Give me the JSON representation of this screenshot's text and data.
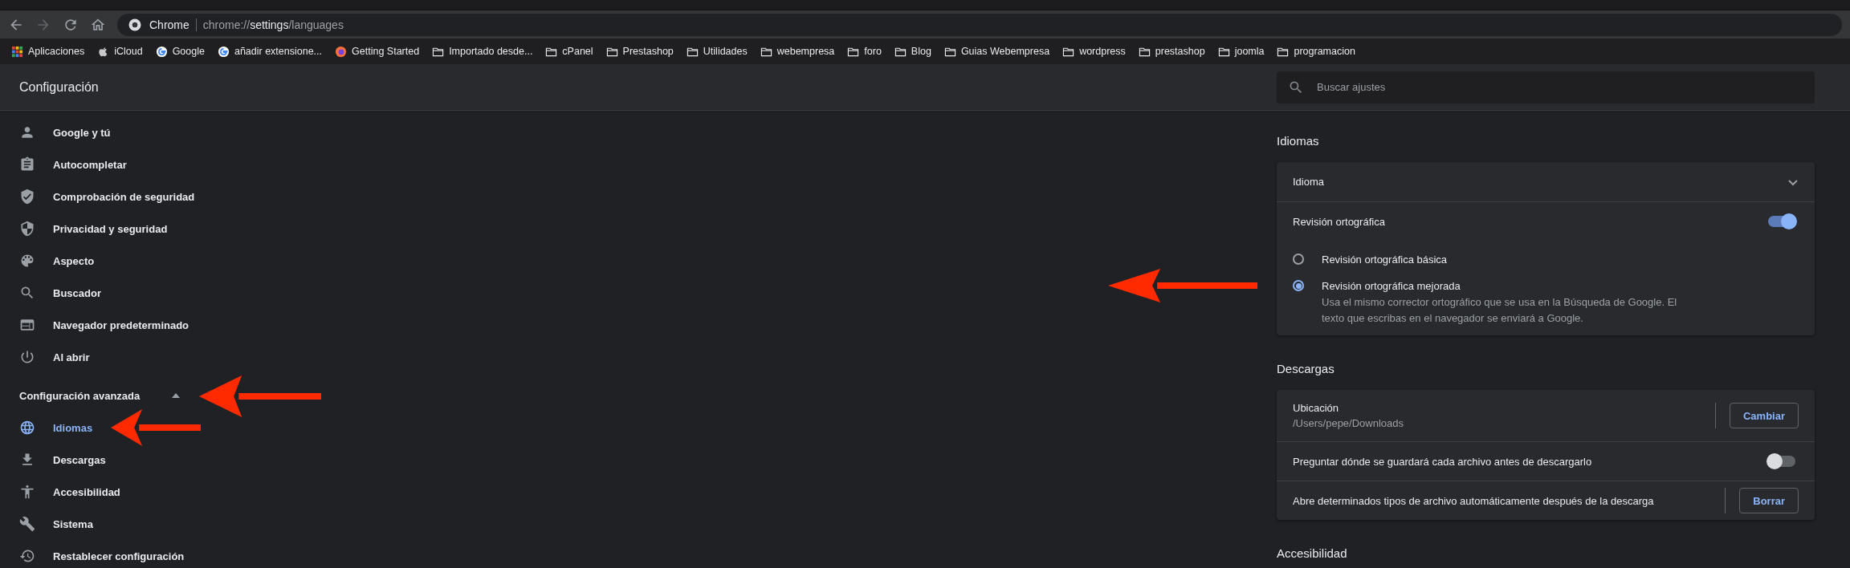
{
  "browser": {
    "address_bar": {
      "site_label": "Chrome",
      "url_scheme": "chrome://",
      "url_host": "settings",
      "url_path": "/languages"
    },
    "bookmarks": [
      {
        "label": "Aplicaciones",
        "kind": "apps"
      },
      {
        "label": "iCloud",
        "kind": "apple"
      },
      {
        "label": "Google",
        "kind": "google"
      },
      {
        "label": "añadir extensione...",
        "kind": "google"
      },
      {
        "label": "Getting Started",
        "kind": "firefox"
      },
      {
        "label": "Importado desde...",
        "kind": "folder"
      },
      {
        "label": "cPanel",
        "kind": "folder"
      },
      {
        "label": "Prestashop",
        "kind": "folder"
      },
      {
        "label": "Utilidades",
        "kind": "folder"
      },
      {
        "label": "webempresa",
        "kind": "folder"
      },
      {
        "label": "foro",
        "kind": "folder"
      },
      {
        "label": "Blog",
        "kind": "folder"
      },
      {
        "label": "Guias Webempresa",
        "kind": "folder"
      },
      {
        "label": "wordpress",
        "kind": "folder"
      },
      {
        "label": "prestashop",
        "kind": "folder"
      },
      {
        "label": "joomla",
        "kind": "folder"
      },
      {
        "label": "programacion",
        "kind": "folder"
      }
    ]
  },
  "settings": {
    "title": "Configuración",
    "search": {
      "placeholder": "Buscar ajustes"
    },
    "sidebar": {
      "items": [
        {
          "label": "Google y tú",
          "selected": false
        },
        {
          "label": "Autocompletar",
          "selected": false
        },
        {
          "label": "Comprobación de seguridad",
          "selected": false
        },
        {
          "label": "Privacidad y seguridad",
          "selected": false
        },
        {
          "label": "Aspecto",
          "selected": false
        },
        {
          "label": "Buscador",
          "selected": false
        },
        {
          "label": "Navegador predeterminado",
          "selected": false
        },
        {
          "label": "Al abrir",
          "selected": false
        }
      ],
      "advanced": {
        "label": "Configuración avanzada",
        "expanded": true
      },
      "advanced_items": [
        {
          "label": "Idiomas",
          "selected": true
        },
        {
          "label": "Descargas",
          "selected": false
        },
        {
          "label": "Accesibilidad",
          "selected": false
        },
        {
          "label": "Sistema",
          "selected": false
        },
        {
          "label": "Restablecer configuración",
          "selected": false
        }
      ]
    },
    "sections": [
      {
        "title": "Idiomas",
        "rows": [
          {
            "kind": "expander",
            "label": "Idioma",
            "expanded": false
          },
          {
            "kind": "toggle",
            "label": "Revisión ortográfica",
            "on": true
          },
          {
            "kind": "radio",
            "label": "Revisión ortográfica básica",
            "selected": false
          },
          {
            "kind": "radio",
            "label": "Revisión ortográfica mejorada",
            "selected": true,
            "description": "Usa el mismo corrector ortográfico que se usa en la Búsqueda de Google. El texto que escribas en el navegador se enviará a Google."
          }
        ]
      },
      {
        "title": "Descargas",
        "rows": [
          {
            "kind": "button",
            "label": "Ubicación",
            "sublabel": "/Users/pepe/Downloads",
            "button": "Cambiar"
          },
          {
            "kind": "toggle",
            "label": "Preguntar dónde se guardará cada archivo antes de descargarlo",
            "on": false
          },
          {
            "kind": "button",
            "label": "Abre determinados tipos de archivo automáticamente después de la descarga",
            "button": "Borrar"
          }
        ]
      },
      {
        "title": "Accesibilidad"
      }
    ]
  }
}
